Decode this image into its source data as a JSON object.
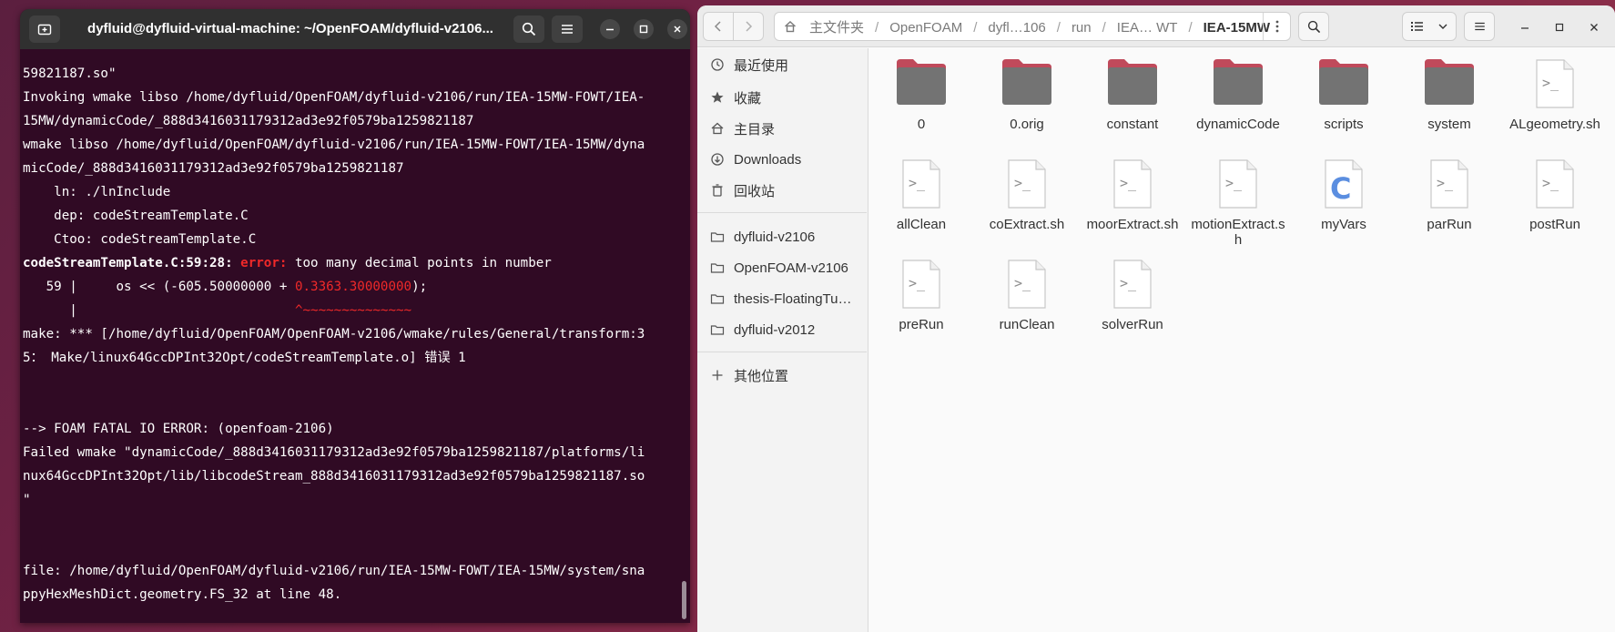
{
  "terminal": {
    "title": "dyfluid@dyfluid-virtual-machine: ~/OpenFOAM/dyfluid-v2106...",
    "lines": [
      [
        {
          "t": "59821187.so\""
        }
      ],
      [
        {
          "t": "Invoking wmake libso /home/dyfluid/OpenFOAM/dyfluid-v2106/run/IEA-15MW-FOWT/IEA-"
        }
      ],
      [
        {
          "t": "15MW/dynamicCode/_888d3416031179312ad3e92f0579ba1259821187"
        }
      ],
      [
        {
          "t": "wmake libso /home/dyfluid/OpenFOAM/dyfluid-v2106/run/IEA-15MW-FOWT/IEA-15MW/dyna"
        }
      ],
      [
        {
          "t": "micCode/_888d3416031179312ad3e92f0579ba1259821187"
        }
      ],
      [
        {
          "t": "    ln: ./lnInclude"
        }
      ],
      [
        {
          "t": "    dep: codeStreamTemplate.C"
        }
      ],
      [
        {
          "t": "    Ctoo: codeStreamTemplate.C"
        }
      ],
      [
        {
          "t": "codeStreamTemplate.C:59:28: ",
          "c": "b"
        },
        {
          "t": "error:",
          "c": "rb"
        },
        {
          "t": " too many decimal points in number"
        }
      ],
      [
        {
          "t": "   59 |     os << (-605.50000000 + "
        },
        {
          "t": "0.3363.30000000",
          "c": "r"
        },
        {
          "t": ");"
        }
      ],
      [
        {
          "t": "      |                            "
        },
        {
          "t": "^~~~~~~~~~~~~~~",
          "c": "r"
        }
      ],
      [
        {
          "t": "make: *** [/home/dyfluid/OpenFOAM/OpenFOAM-v2106/wmake/rules/General/transform:3"
        }
      ],
      [
        {
          "t": "5： Make/linux64GccDPInt32Opt/codeStreamTemplate.o] 错误 1"
        }
      ],
      [
        {
          "t": ""
        }
      ],
      [
        {
          "t": ""
        }
      ],
      [
        {
          "t": "--> FOAM FATAL IO ERROR: (openfoam-2106)"
        }
      ],
      [
        {
          "t": "Failed wmake \"dynamicCode/_888d3416031179312ad3e92f0579ba1259821187/platforms/li"
        }
      ],
      [
        {
          "t": "nux64GccDPInt32Opt/lib/libcodeStream_888d3416031179312ad3e92f0579ba1259821187.so"
        }
      ],
      [
        {
          "t": "\""
        }
      ],
      [
        {
          "t": ""
        }
      ],
      [
        {
          "t": ""
        }
      ],
      [
        {
          "t": "file: /home/dyfluid/OpenFOAM/dyfluid-v2106/run/IEA-15MW-FOWT/IEA-15MW/system/sna"
        }
      ],
      [
        {
          "t": "ppyHexMeshDict.geometry.FS_32 at line 48."
        }
      ]
    ]
  },
  "files": {
    "path": [
      "主文件夹",
      "OpenFOAM",
      "dyfl…106",
      "run",
      "IEA… WT"
    ],
    "current": "IEA-15MW",
    "sidebar": {
      "places": [
        {
          "label": "最近使用",
          "icon": "clock-icon"
        },
        {
          "label": "收藏",
          "icon": "star-icon"
        },
        {
          "label": "主目录",
          "icon": "home-icon"
        },
        {
          "label": "Downloads",
          "icon": "download-icon"
        },
        {
          "label": "回收站",
          "icon": "trash-icon"
        }
      ],
      "bookmarks": [
        {
          "label": "dyfluid-v2106",
          "icon": "folder-icon"
        },
        {
          "label": "OpenFOAM-v2106",
          "icon": "folder-icon"
        },
        {
          "label": "thesis-FloatingTu…",
          "icon": "folder-icon"
        },
        {
          "label": "dyfluid-v2012",
          "icon": "folder-icon"
        }
      ],
      "other": {
        "label": "其他位置",
        "icon": "plus-icon"
      }
    },
    "items": [
      {
        "name": "0",
        "type": "folder"
      },
      {
        "name": "0.orig",
        "type": "folder"
      },
      {
        "name": "constant",
        "type": "folder"
      },
      {
        "name": "dynamicCode",
        "type": "folder"
      },
      {
        "name": "scripts",
        "type": "folder"
      },
      {
        "name": "system",
        "type": "folder"
      },
      {
        "name": "ALgeometry.sh",
        "type": "script"
      },
      {
        "name": "allClean",
        "type": "script"
      },
      {
        "name": "coExtract.sh",
        "type": "script"
      },
      {
        "name": "moorExtract.sh",
        "type": "script"
      },
      {
        "name": "motionExtract.sh",
        "type": "script"
      },
      {
        "name": "myVars",
        "type": "csource"
      },
      {
        "name": "parRun",
        "type": "script"
      },
      {
        "name": "postRun",
        "type": "script"
      },
      {
        "name": "preRun",
        "type": "script"
      },
      {
        "name": "runClean",
        "type": "script"
      },
      {
        "name": "solverRun",
        "type": "script"
      }
    ]
  },
  "colors": {
    "terminal_bg": "#300a24",
    "terminal_error": "#ef2929",
    "folder_tab": "#c04a5b",
    "folder_body": "#737373",
    "c_letter": "#5b8ee0"
  }
}
